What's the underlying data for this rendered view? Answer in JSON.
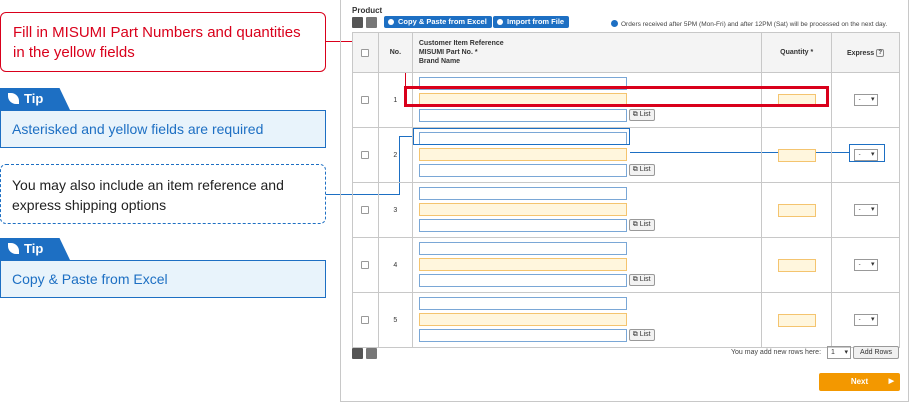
{
  "callouts": {
    "fill_text": "Fill in MISUMI Part Numbers and quantities in the yellow fields",
    "tip1_label": "Tip",
    "tip1_text": "Asterisked and yellow fields are required",
    "info_text": "You may also include an item reference and express shipping options",
    "tip2_label": "Tip",
    "tip2_text": "Copy & Paste from Excel"
  },
  "toolbar": {
    "section_title": "Product",
    "copy_paste_label": "Copy & Paste from Excel",
    "import_label": "Import from File",
    "notice": "Orders received after 5PM (Mon-Fri) and after 12PM (Sat) will be processed on the next day."
  },
  "table": {
    "headers": {
      "no": "No.",
      "ref_line1": "Customer Item Reference",
      "ref_line2": "MISUMI Part No. *",
      "ref_line3": "Brand Name",
      "quantity": "Quantity *",
      "express": "Express",
      "help": "?"
    },
    "rows": [
      {
        "no": "1",
        "express": "-"
      },
      {
        "no": "2",
        "express": "-"
      },
      {
        "no": "3",
        "express": "-"
      },
      {
        "no": "4",
        "express": "-"
      },
      {
        "no": "5",
        "express": "-"
      }
    ],
    "list_label": "List"
  },
  "footer": {
    "add_rows_text": "You may add new rows here:",
    "add_rows_value": "1",
    "add_rows_button": "Add Rows",
    "next_label": "Next",
    "next_arrow": "▶"
  },
  "colors": {
    "accent_red": "#d9001b",
    "accent_blue": "#1d6fc3",
    "required_yellow": "#fff6dd",
    "next_orange": "#f39800"
  }
}
